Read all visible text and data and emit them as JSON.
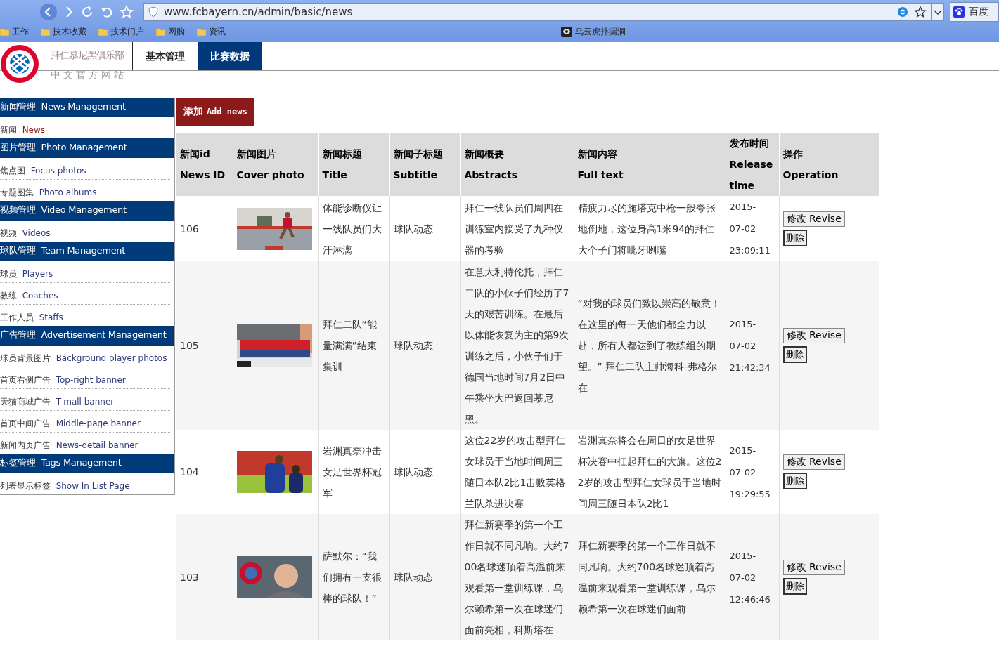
{
  "browser": {
    "url": "www.fcbayern.cn/admin/basic/news",
    "search_engine": "百度",
    "bookmarks": [
      {
        "label": "工作",
        "kind": "folder"
      },
      {
        "label": "技术收藏",
        "kind": "folder"
      },
      {
        "label": "技术门户",
        "kind": "folder"
      },
      {
        "label": "网购",
        "kind": "folder"
      },
      {
        "label": "资讯",
        "kind": "folder"
      },
      {
        "label": "乌云虎扑漏洞",
        "kind": "site"
      }
    ]
  },
  "header": {
    "site_name": "拜仁慕尼黑俱乐部",
    "site_subtitle": "中文官方网站",
    "tabs": [
      {
        "label": "基本管理",
        "selected": false
      },
      {
        "label": "比赛数据",
        "selected": true
      }
    ]
  },
  "sidebar": [
    {
      "title_cn": "新闻管理",
      "title_en": "News Management",
      "items": [
        {
          "cn": "新闻",
          "en": "News",
          "selected": true
        }
      ]
    },
    {
      "title_cn": "图片管理",
      "title_en": "Photo Management",
      "items": [
        {
          "cn": "焦点图",
          "en": "Focus photos",
          "selected": false
        },
        {
          "cn": "专题图集",
          "en": "Photo albums",
          "selected": false
        }
      ]
    },
    {
      "title_cn": "视频管理",
      "title_en": "Video Management",
      "items": [
        {
          "cn": "视频",
          "en": "Videos",
          "selected": false
        }
      ]
    },
    {
      "title_cn": "球队管理",
      "title_en": "Team Management",
      "items": [
        {
          "cn": "球员",
          "en": "Players",
          "selected": false
        },
        {
          "cn": "教练",
          "en": "Coaches",
          "selected": false
        },
        {
          "cn": "工作人员",
          "en": "Staffs",
          "selected": false
        }
      ]
    },
    {
      "title_cn": "广告管理",
      "title_en": "Advertisement Management",
      "items": [
        {
          "cn": "球员背景图片",
          "en": "Background player photos",
          "selected": false
        },
        {
          "cn": "首页右侧广告",
          "en": "Top-right banner",
          "selected": false
        },
        {
          "cn": "天猫商城广告",
          "en": "T-mall banner",
          "selected": false
        },
        {
          "cn": "首页中间广告",
          "en": "Middle-page banner",
          "selected": false
        },
        {
          "cn": "新闻内页广告",
          "en": "News-detail banner",
          "selected": false
        }
      ]
    },
    {
      "title_cn": "标签管理",
      "title_en": "Tags Management",
      "items": [
        {
          "cn": "列表显示标签",
          "en": "Show In List Page",
          "selected": false
        }
      ]
    }
  ],
  "add_button": {
    "cn": "添加",
    "en": "Add news"
  },
  "table": {
    "columns": [
      {
        "cn": "新闻id",
        "en": "News ID"
      },
      {
        "cn": "新闻图片",
        "en": "Cover photo"
      },
      {
        "cn": "新闻标题",
        "en": "Title"
      },
      {
        "cn": "新闻子标题",
        "en": "Subtitle"
      },
      {
        "cn": "新闻概要",
        "en": "Abstracts"
      },
      {
        "cn": "新闻内容",
        "en": "Full text"
      },
      {
        "cn": "发布时间",
        "en": "Release time"
      },
      {
        "cn": "操作",
        "en": "Operation"
      }
    ],
    "rows": [
      {
        "id": "106",
        "title": "体能诊断仪让一线队员们大汗淋漓",
        "subtitle": "球队动态",
        "abstract": "拜仁一线队员们周四在训练室内接受了九种仪器的考验",
        "full_text": "精疲力尽的施塔克中枪一般夸张地倒地，这位身高1米94的拜仁大个子门将呲牙咧嘴",
        "time": "2015-07-02 23:09:11",
        "edit": "修改 Revise",
        "delete": "删除"
      },
      {
        "id": "105",
        "title": "拜仁二队“能量满满”结束集训",
        "subtitle": "球队动态",
        "abstract": "在意大利特伦托，拜仁二队的小伙子们经历了7天的艰苦训练。在最后以体能恢复为主的第9次训练之后，小伙子们于德国当地时间7月2日中午乘坐大巴返回慕尼黑。",
        "full_text": "“对我的球员们致以崇高的敬意！在这里的每一天他们都全力以赴，所有人都达到了教练组的期望。” 拜仁二队主帅海科-弗格尔在",
        "time": "2015-07-02 21:42:34",
        "edit": "修改 Revise",
        "delete": "删除"
      },
      {
        "id": "104",
        "title": "岩渊真奈冲击女足世界杯冠军",
        "subtitle": "球队动态",
        "abstract": "这位22岁的攻击型拜仁女球员于当地时间周三随日本队2比1击败英格兰队杀进决赛",
        "full_text": "岩渊真奈将会在周日的女足世界杯决赛中扛起拜仁的大旗。这位22岁的攻击型拜仁女球员于当地时间周三随日本队2比1",
        "time": "2015-07-02 19:29:55",
        "edit": "修改 Revise",
        "delete": "删除"
      },
      {
        "id": "103",
        "title": "萨默尔：“我们拥有一支很棒的球队！”",
        "subtitle": "球队动态",
        "abstract": "拜仁新赛季的第一个工作日就不同凡响。大约700名球迷顶着高温前来观看第一堂训练课，乌尔赖希第一次在球迷们面前亮相，科斯塔在",
        "full_text": "拜仁新赛季的第一个工作日就不同凡响。大约700名球迷顶着高温前来观看第一堂训练课，乌尔赖希第一次在球迷们面前",
        "time": "2015-07-02 12:46:46",
        "edit": "修改 Revise",
        "delete": "删除"
      }
    ]
  }
}
